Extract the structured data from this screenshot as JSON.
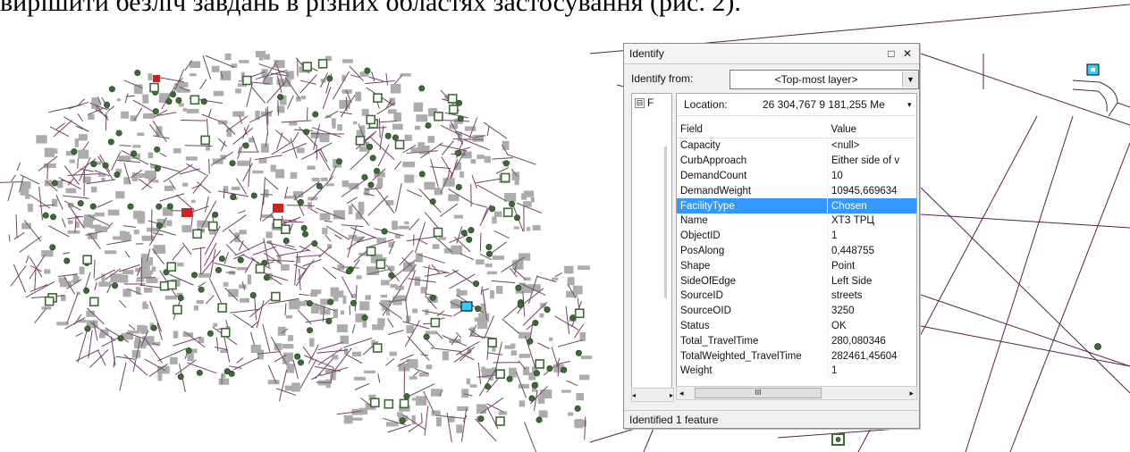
{
  "document": {
    "text": "вирішити безліч завдань в різних областях застосування (рис. 2)."
  },
  "identify": {
    "title": "Identify",
    "window_buttons": {
      "restore": "□",
      "close": "✕"
    },
    "identify_from_label": "Identify from:",
    "identify_from_value": "<Top-most layer>",
    "tree_node": "F",
    "tree_node_toggle": "⊟",
    "location_label": "Location:",
    "location_value": "26 304,767  9 181,255 Me",
    "columns": {
      "field": "Field",
      "value": "Value"
    },
    "rows": [
      {
        "field": "Capacity",
        "value": "<null>"
      },
      {
        "field": "CurbApproach",
        "value": "Either side of v"
      },
      {
        "field": "DemandCount",
        "value": "10"
      },
      {
        "field": "DemandWeight",
        "value": "10945,669634"
      },
      {
        "field": "FacilityType",
        "value": "Chosen"
      },
      {
        "field": "Name",
        "value": "ХТЗ ТРЦ"
      },
      {
        "field": "ObjectID",
        "value": "1"
      },
      {
        "field": "PosAlong",
        "value": "0,448755"
      },
      {
        "field": "Shape",
        "value": "Point"
      },
      {
        "field": "SideOfEdge",
        "value": "Left Side"
      },
      {
        "field": "SourceID",
        "value": "streets"
      },
      {
        "field": "SourceOID",
        "value": "3250"
      },
      {
        "field": "Status",
        "value": "OK"
      },
      {
        "field": "Total_TravelTime",
        "value": "280,080346"
      },
      {
        "field": "TotalWeighted_TravelTime",
        "value": "282461,45604"
      },
      {
        "field": "Weight",
        "value": "1"
      }
    ],
    "selected_row": 4,
    "status": "Identified 1 feature",
    "scroll_thumb_label": "III"
  },
  "colors": {
    "street": "#5a1f4a",
    "facility_green": "#3d6b35",
    "chosen_red": "#cc2222",
    "selected_cyan": "#33ccff",
    "selection_blue": "#3399ff"
  }
}
